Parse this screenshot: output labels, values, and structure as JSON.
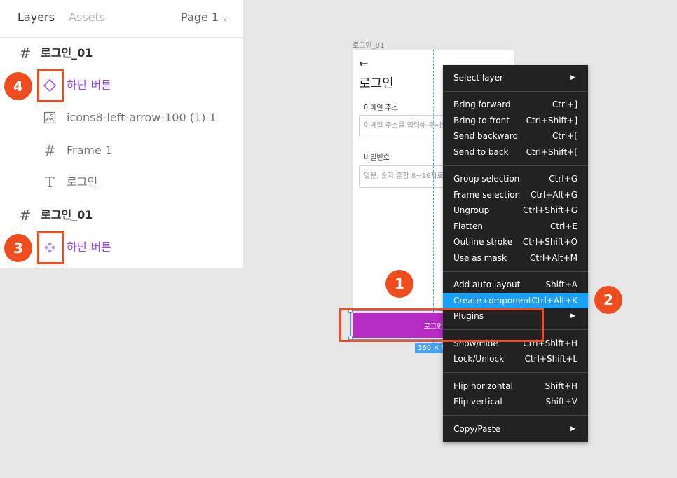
{
  "layers_panel": {
    "tabs": {
      "layers": "Layers",
      "assets": "Assets"
    },
    "page_selector": "Page 1",
    "layers": [
      {
        "label": "로그인_01"
      },
      {
        "label": "하단 버튼"
      },
      {
        "label": "icons8-left-arrow-100 (1) 1"
      },
      {
        "label": "Frame 1"
      },
      {
        "label": "로그인"
      },
      {
        "label": "로그인_01"
      },
      {
        "label": "하단 버튼"
      }
    ]
  },
  "badges": {
    "one": "1",
    "two": "2",
    "three": "3",
    "four": "4"
  },
  "canvas": {
    "frame_label": "로그인_01",
    "back_arrow": "←",
    "title": "로그인",
    "email_label": "이메일 주소",
    "email_placeholder": "이메일 주소를 입력해 주세요",
    "password_label": "비밀번호",
    "password_placeholder": "영문, 숫자 혼합 8~16자로 입",
    "button_label": "로그인",
    "size_label": "360 × 5"
  },
  "context_menu": {
    "items": [
      {
        "label": "Select layer",
        "submenu": "▶"
      },
      {
        "label": "Bring forward",
        "shortcut": "Ctrl+]"
      },
      {
        "label": "Bring to front",
        "shortcut": "Ctrl+Shift+]"
      },
      {
        "label": "Send backward",
        "shortcut": "Ctrl+["
      },
      {
        "label": "Send to back",
        "shortcut": "Ctrl+Shift+["
      },
      {
        "label": "Group selection",
        "shortcut": "Ctrl+G"
      },
      {
        "label": "Frame selection",
        "shortcut": "Ctrl+Alt+G"
      },
      {
        "label": "Ungroup",
        "shortcut": "Ctrl+Shift+G"
      },
      {
        "label": "Flatten",
        "shortcut": "Ctrl+E"
      },
      {
        "label": "Outline stroke",
        "shortcut": "Ctrl+Shift+O"
      },
      {
        "label": "Use as mask",
        "shortcut": "Ctrl+Alt+M"
      },
      {
        "label": "Add auto layout",
        "shortcut": "Shift+A"
      },
      {
        "label": "Create component",
        "shortcut": "Ctrl+Alt+K"
      },
      {
        "label": "Plugins",
        "submenu": "▶"
      },
      {
        "label": "Show/Hide",
        "shortcut": "Ctrl+Shift+H"
      },
      {
        "label": "Lock/Unlock",
        "shortcut": "Ctrl+Shift+L"
      },
      {
        "label": "Flip horizontal",
        "shortcut": "Shift+H"
      },
      {
        "label": "Flip vertical",
        "shortcut": "Shift+V"
      },
      {
        "label": "Copy/Paste",
        "submenu": "▶"
      }
    ]
  },
  "colors": {
    "highlight": "#ef4d1d",
    "component": "#9747ff",
    "menu_bg": "#222222",
    "menu_active": "#18a0fb",
    "button_bg": "#b42cc2",
    "selection": "#4aa3f0"
  }
}
